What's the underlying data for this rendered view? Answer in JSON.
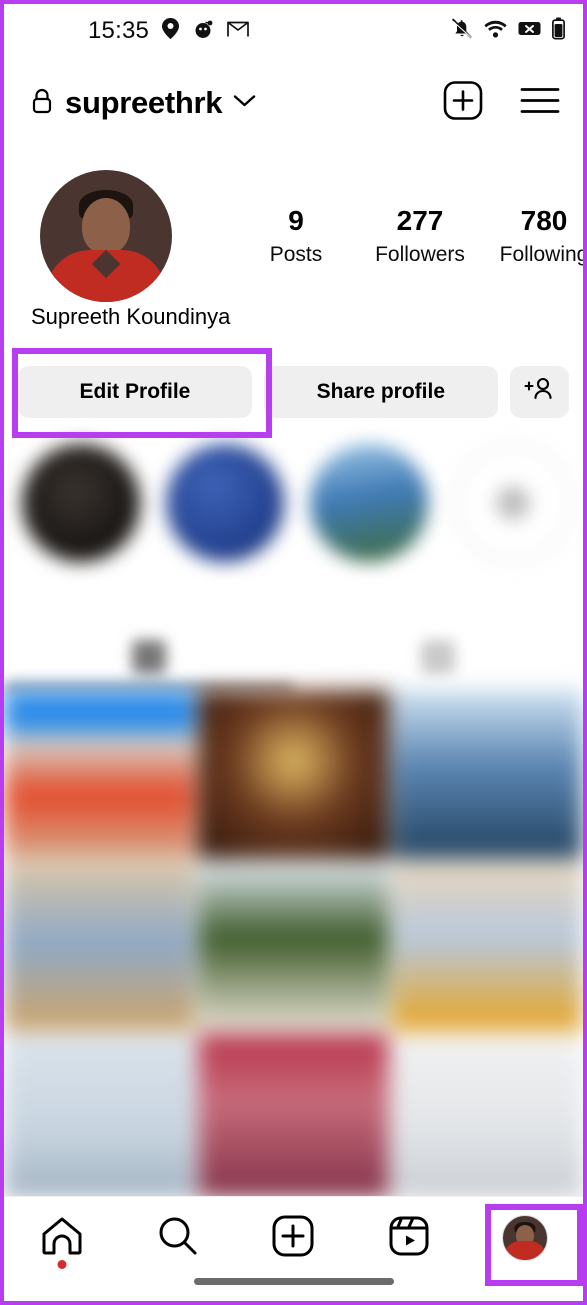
{
  "annotations": {
    "color": "#b83cf0",
    "edit_profile_box": "edit-profile-highlight",
    "profile_tab_box": "profile-tab-highlight"
  },
  "status_bar": {
    "time": "15:35",
    "left_icons": [
      "location-pin-icon",
      "reddit-icon",
      "gmail-icon"
    ],
    "right_icons": [
      "notifications-off-icon",
      "wifi-icon",
      "no-sim-icon",
      "battery-icon"
    ]
  },
  "header": {
    "lock_icon": "lock-icon",
    "username": "supreethrk",
    "chevron": "chevron-down-icon",
    "actions": [
      "new-post-icon",
      "menu-icon"
    ]
  },
  "profile": {
    "avatar": "profile-avatar",
    "full_name": "Supreeth Koundinya",
    "stats": [
      {
        "value": "9",
        "label": "Posts"
      },
      {
        "value": "277",
        "label": "Followers"
      },
      {
        "value": "780",
        "label": "Following"
      }
    ]
  },
  "actions": {
    "edit_profile": "Edit Profile",
    "share_profile": "Share profile",
    "add_person_icon": "add-person-icon"
  },
  "highlights": {
    "items": [
      {
        "label": ""
      },
      {
        "label": ""
      },
      {
        "label": ""
      },
      {
        "label": ""
      }
    ]
  },
  "tabs": [
    {
      "name": "grid-tab",
      "icon": "grid-icon",
      "active": true
    },
    {
      "name": "tagged-tab",
      "icon": "tagged-icon",
      "active": false
    }
  ],
  "grid": {
    "posts": [
      "p1",
      "p2",
      "p3",
      "p4",
      "p5",
      "p6",
      "p7",
      "p8",
      "p9"
    ]
  },
  "bottom_nav": {
    "items": [
      {
        "name": "home",
        "icon": "home-icon",
        "badge": true
      },
      {
        "name": "search",
        "icon": "search-icon",
        "badge": false
      },
      {
        "name": "create",
        "icon": "plus-square-icon",
        "badge": false
      },
      {
        "name": "reels",
        "icon": "reels-icon",
        "badge": false
      },
      {
        "name": "profile",
        "icon": "profile-avatar-icon",
        "badge": false
      }
    ],
    "home_indicator": "home-indicator"
  }
}
